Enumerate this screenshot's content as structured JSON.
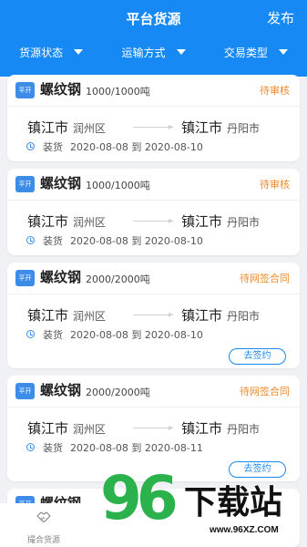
{
  "header": {
    "title": "平台货源",
    "publish_label": "发布",
    "background_color": "#1689f4"
  },
  "filters": [
    {
      "label": "货源状态"
    },
    {
      "label": "运输方式"
    },
    {
      "label": "交易类型"
    }
  ],
  "cards": [
    {
      "badge": "平开",
      "goods": "螺纹钢",
      "quantity": "1000/1000吨",
      "status": "待审核",
      "from_city": "镇江市",
      "from_district": "润州区",
      "to_city": "镇江市",
      "to_district": "丹阳市",
      "load_label": "装货",
      "dates": "2020-08-08 到 2020-08-10",
      "action": ""
    },
    {
      "badge": "平开",
      "goods": "螺纹钢",
      "quantity": "1000/1000吨",
      "status": "待审核",
      "from_city": "镇江市",
      "from_district": "润州区",
      "to_city": "镇江市",
      "to_district": "丹阳市",
      "load_label": "装货",
      "dates": "2020-08-08 到 2020-08-10",
      "action": ""
    },
    {
      "badge": "平开",
      "goods": "螺纹钢",
      "quantity": "2000/2000吨",
      "status": "待网签合同",
      "from_city": "镇江市",
      "from_district": "润州区",
      "to_city": "镇江市",
      "to_district": "丹阳市",
      "load_label": "装货",
      "dates": "2020-08-08 到 2020-08-10",
      "action": "去签约"
    },
    {
      "badge": "平开",
      "goods": "螺纹钢",
      "quantity": "2000/2000吨",
      "status": "待网签合同",
      "from_city": "镇江市",
      "from_district": "润州区",
      "to_city": "镇江市",
      "to_district": "丹阳市",
      "load_label": "装货",
      "dates": "2020-08-08 到 2020-08-11",
      "action": "去签约"
    },
    {
      "badge": "平开",
      "goods": "螺纹钢",
      "quantity": "",
      "status": "",
      "from_city": "",
      "from_district": "",
      "to_city": "",
      "to_district": "",
      "load_label": "",
      "dates": "",
      "action": ""
    }
  ],
  "tabbar": {
    "items": [
      {
        "label": "撮合货源",
        "icon": "handshake-icon"
      }
    ]
  },
  "watermark": {
    "number": "96",
    "name": "下载站",
    "url": "www.96XZ.COM"
  },
  "colors": {
    "accent": "#1689f4",
    "status": "#f08a2a",
    "background": "#f0f1f5",
    "watermark_green": "#2bb24c"
  }
}
